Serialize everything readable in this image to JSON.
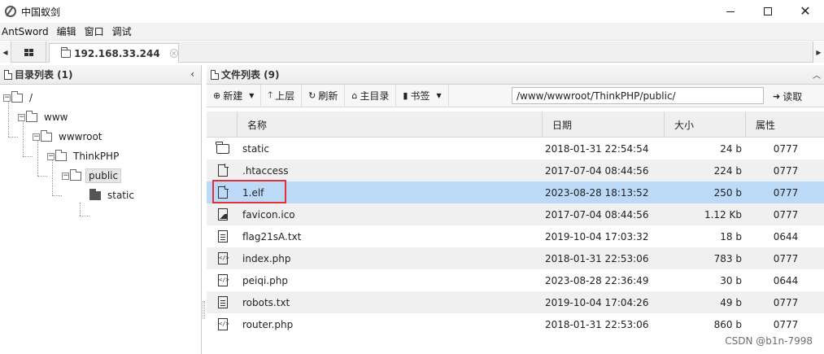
{
  "window": {
    "title": "中国蚁剑",
    "controls": {
      "minimize": "minimize",
      "maximize": "maximize",
      "close": "✕"
    }
  },
  "menu": [
    "AntSword",
    "编辑",
    "窗口",
    "调试"
  ],
  "tabs": {
    "left_arrow": "◀",
    "right_arrow": "▶",
    "host_label": "192.168.33.244",
    "close_symbol": "×"
  },
  "dir_panel": {
    "title": "目录列表 (1)",
    "collapse_symbol": "‹",
    "tree": [
      {
        "label": "/",
        "toggle": "−"
      },
      {
        "label": "www",
        "toggle": "−"
      },
      {
        "label": "wwwroot",
        "toggle": "−"
      },
      {
        "label": "ThinkPHP",
        "toggle": "−"
      },
      {
        "label": "public",
        "toggle": "−",
        "selected": true
      },
      {
        "label": "static",
        "toggle": ""
      }
    ]
  },
  "file_panel": {
    "title": "文件列表 (9)",
    "collapse_symbol": "︿",
    "toolbar": {
      "new_label": "新建",
      "up_label": "上层",
      "refresh_label": "刷新",
      "home_label": "主目录",
      "bookmark_label": "书签",
      "path_value": "/www/wwwroot/ThinkPHP/public/",
      "read_label": "读取"
    },
    "columns": {
      "name": "名称",
      "date": "日期",
      "size": "大小",
      "attr": "属性"
    },
    "files": [
      {
        "icon": "folder-icon",
        "name": "static",
        "date": "2018-01-31 22:54:54",
        "size": "24 b",
        "attr": "0777"
      },
      {
        "icon": "file-icon",
        "name": ".htaccess",
        "date": "2017-07-04 08:44:56",
        "size": "224 b",
        "attr": "0777"
      },
      {
        "icon": "file-icon",
        "name": "1.elf",
        "date": "2023-08-28 18:13:52",
        "size": "250 b",
        "attr": "0777",
        "selected": true
      },
      {
        "icon": "image-file-icon",
        "name": "favicon.ico",
        "date": "2017-07-04 08:44:56",
        "size": "1.12 Kb",
        "attr": "0777"
      },
      {
        "icon": "text-file-icon",
        "name": "flag21sA.txt",
        "date": "2019-10-04 17:03:32",
        "size": "18 b",
        "attr": "0644"
      },
      {
        "icon": "code-file-icon",
        "name": "index.php",
        "date": "2018-01-31 22:53:06",
        "size": "783 b",
        "attr": "0777"
      },
      {
        "icon": "code-file-icon",
        "name": "peiqi.php",
        "date": "2023-08-28 22:36:49",
        "size": "30 b",
        "attr": "0644"
      },
      {
        "icon": "text-file-icon",
        "name": "robots.txt",
        "date": "2019-10-04 17:04:26",
        "size": "49 b",
        "attr": "0777"
      },
      {
        "icon": "code-file-icon",
        "name": "router.php",
        "date": "2018-01-31 22:53:06",
        "size": "860 b",
        "attr": "0777"
      }
    ]
  },
  "watermark": "CSDN @b1n-7998",
  "colors": {
    "selected_row": "#bcd9f7",
    "highlight_border": "#e0303a",
    "stripe": "#f0f0f0"
  }
}
